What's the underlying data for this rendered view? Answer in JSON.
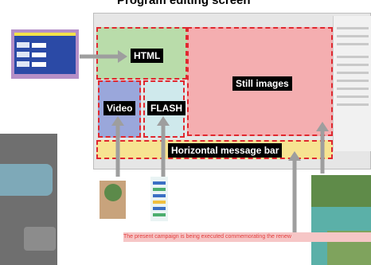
{
  "title": "Program editing screen",
  "regions": {
    "html": "HTML",
    "still": "Still images",
    "video": "Video",
    "flash": "FLASH",
    "message_bar": "Horizontal message bar"
  },
  "ticker_text": "The present campaign is being executed commemorating the renew",
  "colors": {
    "dashed_border": "#e0282f",
    "html_region": "#b9dcaa",
    "still_region": "#f4aeb0",
    "video_region": "#9aa7db",
    "flash_region": "#cfe9ec",
    "message_bar_region": "#f7e391",
    "arrow": "#9e9e9e",
    "label_bg": "#000000"
  },
  "icons": [
    "arrow-right-icon",
    "arrow-up-icon"
  ]
}
